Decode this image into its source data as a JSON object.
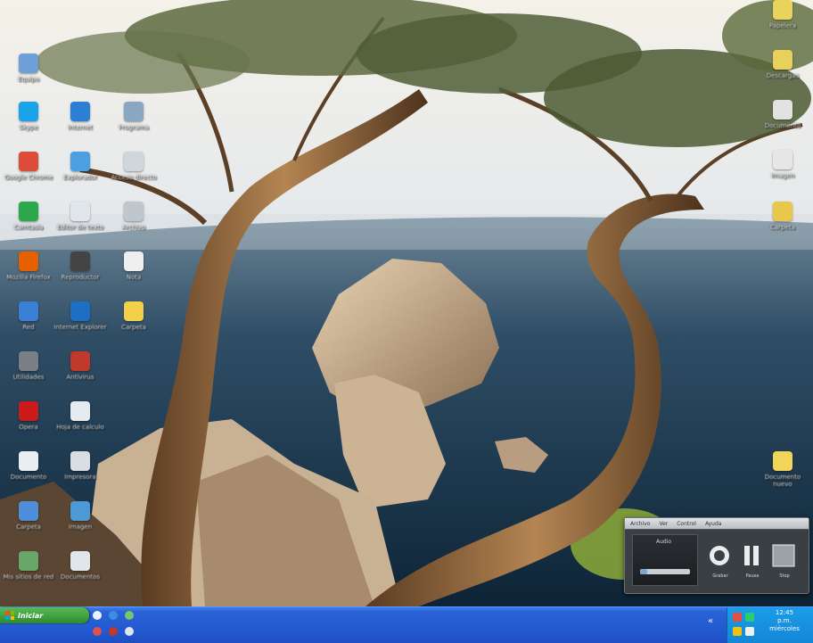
{
  "desktop": {
    "icons": [
      {
        "label": "Equipo",
        "glyph": "computer-icon",
        "color": "#6f9fd8"
      },
      {
        "label": "Skype",
        "glyph": "skype-icon",
        "color": "#1aa3e8"
      },
      {
        "label": "Google Chrome",
        "glyph": "chrome-icon",
        "color": "#dd4b39"
      },
      {
        "label": "Camtasia",
        "glyph": "camtasia-icon",
        "color": "#2ca84a"
      },
      {
        "label": "Mozilla Firefox",
        "glyph": "firefox-icon",
        "color": "#e66000"
      },
      {
        "label": "Red",
        "glyph": "network-icon",
        "color": "#3b7fd6"
      },
      {
        "label": "Utilidades",
        "glyph": "disc-icon",
        "color": "#7a7f86"
      },
      {
        "label": "Opera",
        "glyph": "opera-icon",
        "color": "#cc1b1b"
      },
      {
        "label": "Documento",
        "glyph": "document-icon",
        "color": "#e9eef3"
      },
      {
        "label": "Carpeta",
        "glyph": "folder-icon",
        "color": "#4f8fd9"
      },
      {
        "label": "Mis sitios de red",
        "glyph": "network-places-icon",
        "color": "#6aa56a"
      },
      {
        "label": "Internet",
        "glyph": "ie-icon",
        "color": "#2d7fd3"
      },
      {
        "label": "Explorador",
        "glyph": "explorer-icon",
        "color": "#4aa0e0"
      },
      {
        "label": "Editor de texto",
        "glyph": "notepad-icon",
        "color": "#dfe5ea"
      },
      {
        "label": "Reproductor",
        "glyph": "media-icon",
        "color": "#444"
      },
      {
        "label": "Internet Explorer",
        "glyph": "globe-icon",
        "color": "#1c6fc2"
      },
      {
        "label": "Antivirus",
        "glyph": "shield-icon",
        "color": "#c0392b"
      },
      {
        "label": "Hoja de calculo",
        "glyph": "sheet-icon",
        "color": "#e6ebef"
      },
      {
        "label": "Impresora",
        "glyph": "printer-icon",
        "color": "#d9dee3"
      },
      {
        "label": "Imagen",
        "glyph": "image-icon",
        "color": "#4b9ad6"
      },
      {
        "label": "Documentos",
        "glyph": "docs-icon",
        "color": "#e1e6eb"
      },
      {
        "label": "Programa",
        "glyph": "app-icon",
        "color": "#8aa7c2"
      },
      {
        "label": "Acceso directo",
        "glyph": "shortcut-icon",
        "color": "#cfd6dc"
      },
      {
        "label": "Archivo",
        "glyph": "file-icon",
        "color": "#bfc6cc"
      },
      {
        "label": "Nota",
        "glyph": "note-icon",
        "color": "#eee"
      },
      {
        "label": "Carpeta",
        "glyph": "folder-yellow-icon",
        "color": "#f2d04a"
      },
      {
        "label": "Papelera",
        "glyph": "recycle-icon",
        "color": "#e9d35c"
      },
      {
        "label": "Descargas",
        "glyph": "download-icon",
        "color": "#e8d05b"
      },
      {
        "label": "Documento",
        "glyph": "doc-red-icon",
        "color": "#e2e2e2"
      },
      {
        "label": "Imagen",
        "glyph": "pdf-icon",
        "color": "#e6e6e6"
      },
      {
        "label": "Carpeta",
        "glyph": "folder-icon",
        "color": "#e9c74a"
      },
      {
        "label": "Documento nuevo",
        "glyph": "new-doc-icon",
        "color": "#f1d55b"
      }
    ]
  },
  "player": {
    "menu": [
      "Archivo",
      "Ver",
      "Control",
      "Ayuda"
    ],
    "volume_label": "Audio",
    "progress": 0.15,
    "buttons": {
      "record": "Grabar",
      "pause": "Pausa",
      "stop": "Stop"
    }
  },
  "taskbar": {
    "start_label": "Iniciar",
    "clock_line1": "12:45",
    "clock_line2": "p.m.",
    "clock_line3": "miércoles"
  }
}
